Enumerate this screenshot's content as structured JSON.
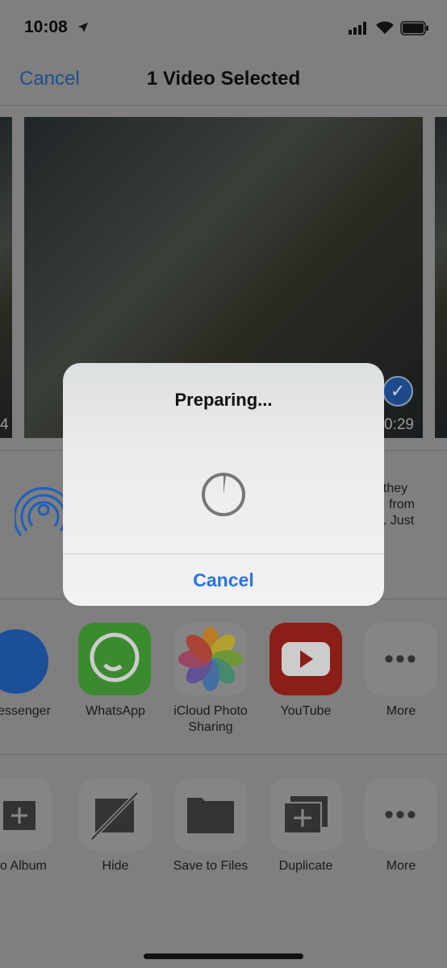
{
  "status_bar": {
    "time": "10:08",
    "icons": [
      "location-arrow-icon",
      "signal-icon",
      "wifi-icon",
      "battery-icon"
    ]
  },
  "nav": {
    "cancel": "Cancel",
    "title": "1 Video Selected"
  },
  "thumbnails": {
    "left_duration": "4",
    "selected_duration": "0:29",
    "selected": true
  },
  "airdrop": {
    "text_lines": [
      "f they",
      "from",
      "e. Just"
    ],
    "accent": "#1f5fbf"
  },
  "apps": [
    {
      "label": "essenger",
      "icon": "messenger-icon"
    },
    {
      "label": "WhatsApp",
      "icon": "whatsapp-icon"
    },
    {
      "label": "iCloud Photo Sharing",
      "icon": "photos-icon"
    },
    {
      "label": "YouTube",
      "icon": "youtube-icon"
    },
    {
      "label": "More",
      "icon": "more-icon"
    }
  ],
  "actions": [
    {
      "label": "d to Album",
      "icon": "add-to-album-icon"
    },
    {
      "label": "Hide",
      "icon": "hide-icon"
    },
    {
      "label": "Save to Files",
      "icon": "folder-icon"
    },
    {
      "label": "Duplicate",
      "icon": "duplicate-icon"
    },
    {
      "label": "More",
      "icon": "more-icon"
    }
  ],
  "alert": {
    "title": "Preparing...",
    "cancel": "Cancel",
    "progress_percent": 2,
    "accent": "#2c74e4"
  }
}
